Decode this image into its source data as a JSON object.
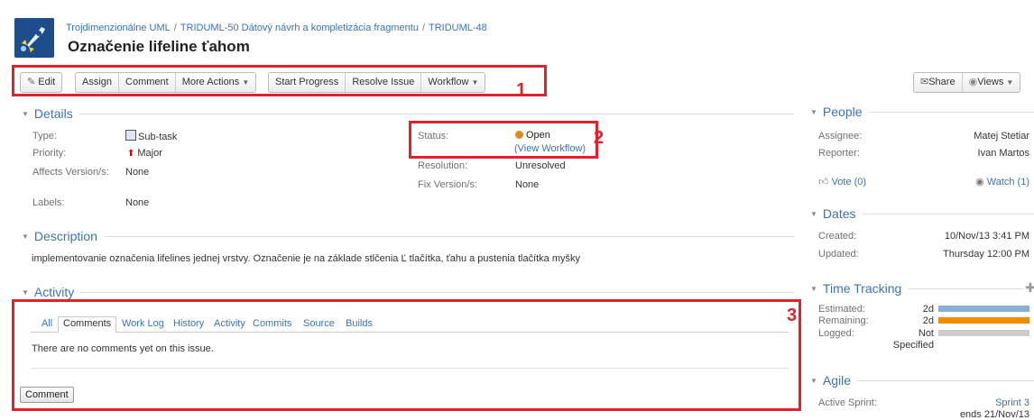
{
  "breadcrumb": {
    "project": "Trojdimenzionálne UML",
    "parent": "TRIDUML-50 Dátový návrh a kompletizácia fragmentu",
    "issue_key": "TRIDUML-48",
    "separator": "/"
  },
  "issue": {
    "title": "Označenie lifeline ťahom"
  },
  "toolbar": {
    "edit": "Edit",
    "assign": "Assign",
    "comment": "Comment",
    "more_actions": "More Actions",
    "start_progress": "Start Progress",
    "resolve_issue": "Resolve Issue",
    "workflow": "Workflow",
    "share": "Share",
    "views": "Views"
  },
  "annotations": {
    "n1": "1",
    "n2": "2",
    "n3": "3"
  },
  "details": {
    "heading": "Details",
    "type_label": "Type:",
    "type_value": "Sub-task",
    "priority_label": "Priority:",
    "priority_value": "Major",
    "affects_label": "Affects Version/s:",
    "affects_value": "None",
    "labels_label": "Labels:",
    "labels_value": "None",
    "status_label": "Status:",
    "status_value": "Open",
    "view_workflow": "(View Workflow)",
    "resolution_label": "Resolution:",
    "resolution_value": "Unresolved",
    "fix_label": "Fix Version/s:",
    "fix_value": "None"
  },
  "description": {
    "heading": "Description",
    "text": "implementovanie označenia lifelines jednej vrstvy. Označenie je na základe stlčenia Ľ tlačítka, ťahu a pustenia tlačítka myšky"
  },
  "activity": {
    "heading": "Activity",
    "tabs": [
      "All",
      "Comments",
      "Work Log",
      "History",
      "Activity",
      "Commits",
      "Source",
      "Builds"
    ],
    "active_tab": "Comments",
    "empty_message": "There are no comments yet on this issue.",
    "comment_button": "Comment"
  },
  "people": {
    "heading": "People",
    "assignee_label": "Assignee:",
    "assignee_value": "Matej Stetiar",
    "reporter_label": "Reporter:",
    "reporter_value": "Ivan Martos",
    "vote": "Vote (0)",
    "watch": "Watch (1)"
  },
  "dates": {
    "heading": "Dates",
    "created_label": "Created:",
    "created_value": "10/Nov/13 3:41 PM",
    "updated_label": "Updated:",
    "updated_value": "Thursday 12:00 PM"
  },
  "time_tracking": {
    "heading": "Time Tracking",
    "estimated_label": "Estimated:",
    "estimated_value": "2d",
    "estimated_fraction": 1.0,
    "remaining_label": "Remaining:",
    "remaining_value": "2d",
    "remaining_fraction": 1.0,
    "logged_label": "Logged:",
    "logged_value_line1": "Not",
    "logged_value_line2": "Specified",
    "logged_fraction": 0.0,
    "colors": {
      "estimated": "#89afd7",
      "remaining": "#ec8e00",
      "logged": "#cccccc"
    }
  },
  "agile": {
    "heading": "Agile",
    "active_sprint_label": "Active Sprint:",
    "sprint_value": "Sprint 3",
    "sprint_ends": "ends 21/Nov/13"
  },
  "colors": {
    "link": "#3b73af",
    "annotation_red": "#e3202b"
  }
}
